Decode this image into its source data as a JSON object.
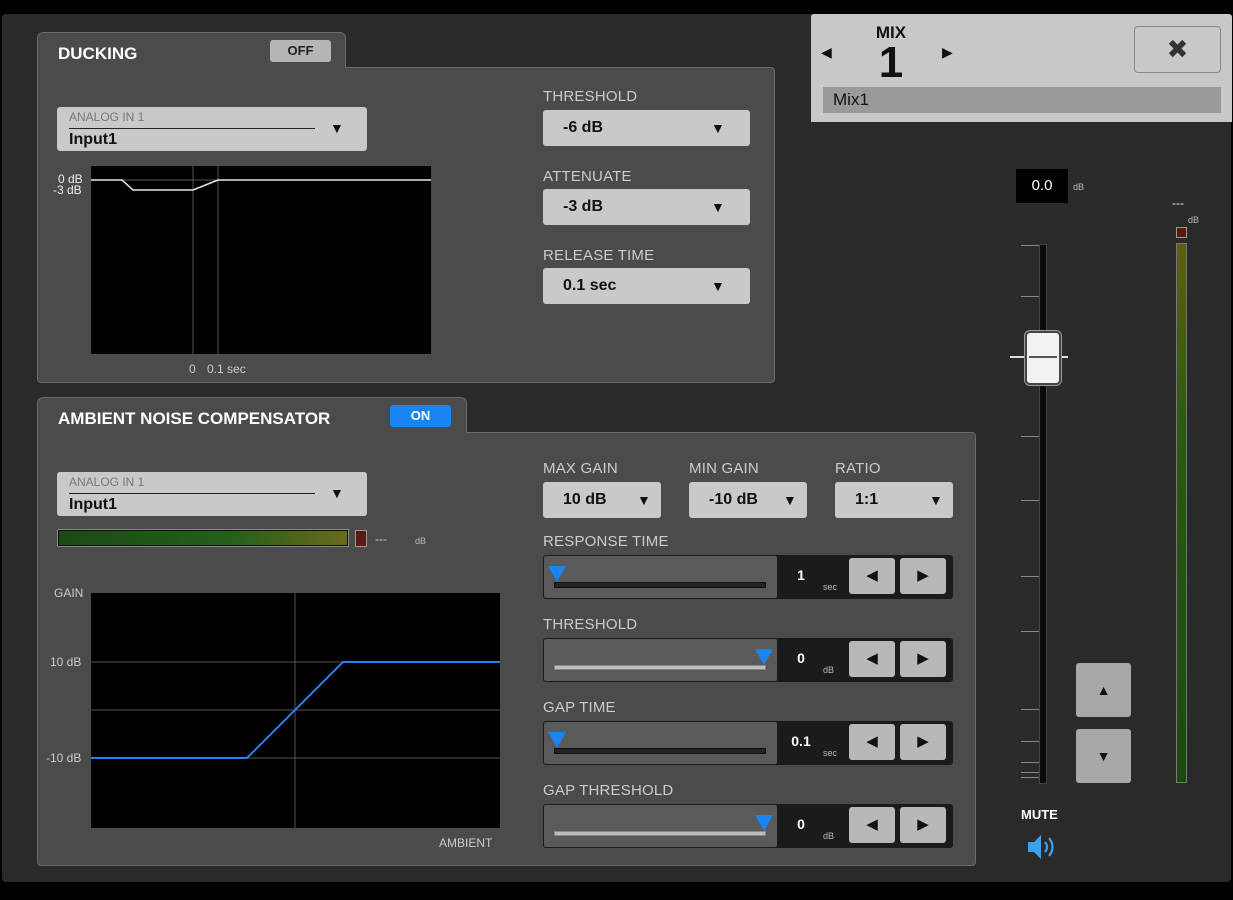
{
  "mix": {
    "label": "MIX",
    "number": "1",
    "name": "Mix1",
    "prev": "◀",
    "next": "▶",
    "close": "✖"
  },
  "ducking": {
    "title": "DUCKING",
    "state": "OFF",
    "source_sub": "ANALOG IN 1",
    "source": "Input1",
    "graph_ylabels": [
      "0 dB",
      "-3 dB"
    ],
    "graph_xlabels": [
      "0",
      "0.1 sec"
    ],
    "threshold_label": "THRESHOLD",
    "threshold": "-6 dB",
    "attenuate_label": "ATTENUATE",
    "attenuate": "-3 dB",
    "release_label": "RELEASE TIME",
    "release": "0.1 sec"
  },
  "anc": {
    "title": "AMBIENT NOISE COMPENSATOR",
    "state": "ON",
    "source_sub": "ANALOG IN 1",
    "source": "Input1",
    "meter_value": "---",
    "meter_unit": "dB",
    "graph_ylabel": "GAIN",
    "graph_xlabel": "AMBIENT",
    "graph_ticks": [
      "10 dB",
      "-10 dB"
    ],
    "max_gain_label": "MAX GAIN",
    "max_gain": "10 dB",
    "min_gain_label": "MIN GAIN",
    "min_gain": "-10 dB",
    "ratio_label": "RATIO",
    "ratio": "1:1",
    "sliders": [
      {
        "label": "RESPONSE TIME",
        "value": "1",
        "unit": "sec",
        "fraction": 0.0
      },
      {
        "label": "THRESHOLD",
        "value": "0",
        "unit": "dB",
        "fraction": 1.0
      },
      {
        "label": "GAP TIME",
        "value": "0.1",
        "unit": "sec",
        "fraction": 0.0
      },
      {
        "label": "GAP THRESHOLD",
        "value": "0",
        "unit": "dB",
        "fraction": 1.0
      }
    ]
  },
  "fader": {
    "value": "0.0",
    "unit": "dB",
    "meter_value": "---",
    "meter_unit": "dB",
    "up": "▲",
    "down": "▼",
    "mute_label": "MUTE"
  },
  "icons": {
    "dropdown_arrow": "▼",
    "left": "◀",
    "right": "▶"
  },
  "colors": {
    "accent": "#1a84f0",
    "panel": "#4b4b4b",
    "background": "#2a2a2a"
  }
}
